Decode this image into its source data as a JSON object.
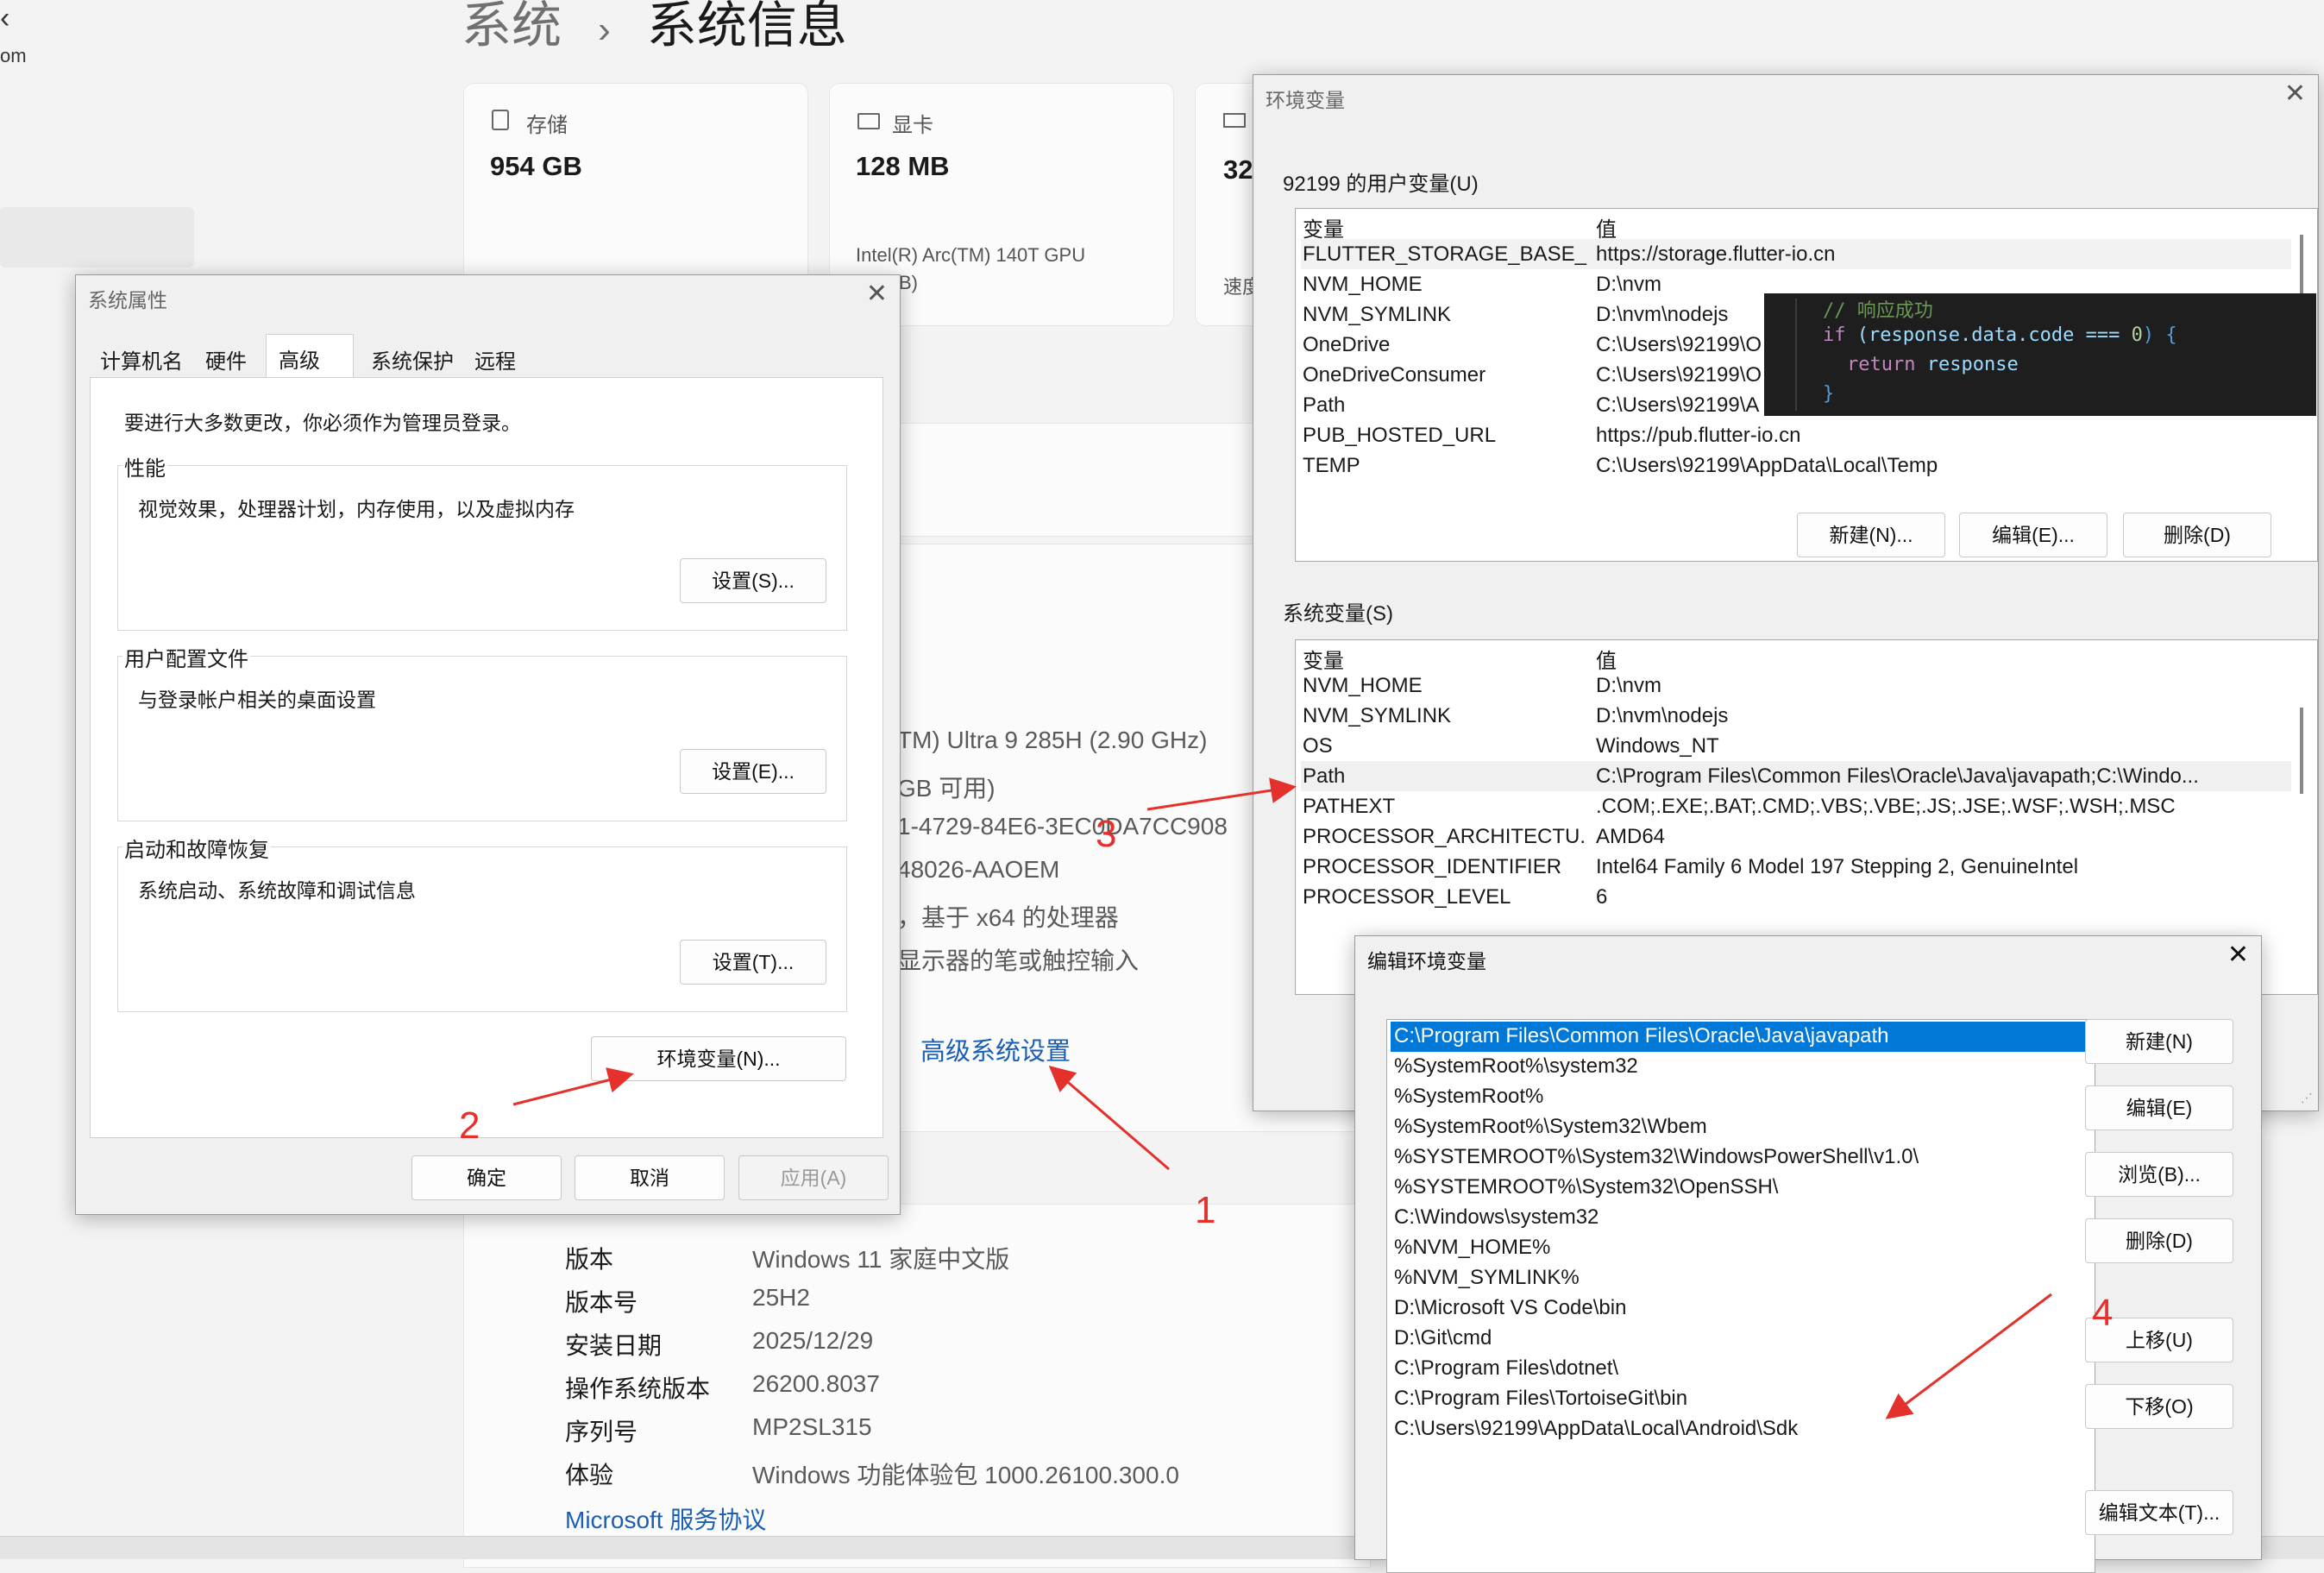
{
  "settings": {
    "partial_left": "om",
    "breadcrumb_parent": "系统",
    "breadcrumb_sep": "›",
    "breadcrumb_current": "系统信息",
    "cards": [
      {
        "label": "存储",
        "value": "954 GB",
        "sub": ""
      },
      {
        "label": "显卡",
        "value": "128 MB",
        "sub": "Intel(R) Arc(TM) 140T GPU",
        "sub2": "B)"
      },
      {
        "label": "",
        "value": "32",
        "sub": "速度"
      }
    ],
    "spec_partial": [
      "TM) Ultra 9 285H (2.90 GHz)",
      "GB 可用)",
      "1-4729-84E6-3EC0DA7CC908",
      "48026-AAOEM",
      "基于 x64 的处理器",
      "显示器的笔或触控输入"
    ],
    "spec_prefix_comma": "，",
    "advanced_link": "高级系统设置",
    "windows_specs": [
      {
        "k": "版本",
        "v": "Windows 11 家庭中文版"
      },
      {
        "k": "版本号",
        "v": "25H2"
      },
      {
        "k": "安装日期",
        "v": "2025/12/29"
      },
      {
        "k": "操作系统版本",
        "v": "26200.8037"
      },
      {
        "k": "序列号",
        "v": "MP2SL315"
      },
      {
        "k": "体验",
        "v": "Windows 功能体验包 1000.26100.300.0"
      }
    ],
    "msa_link": "Microsoft 服务协议"
  },
  "sysprops": {
    "title": "系统属性",
    "close": "✕",
    "tabs": [
      "计算机名",
      "硬件",
      "高级",
      "系统保护",
      "远程"
    ],
    "admin_note": "要进行大多数更改，你必须作为管理员登录。",
    "groups": [
      {
        "label": "性能",
        "desc": "视觉效果，处理器计划，内存使用，以及虚拟内存",
        "button": "设置(S)..."
      },
      {
        "label": "用户配置文件",
        "desc": "与登录帐户相关的桌面设置",
        "button": "设置(E)..."
      },
      {
        "label": "启动和故障恢复",
        "desc": "系统启动、系统故障和调试信息",
        "button": "设置(T)..."
      }
    ],
    "env_button": "环境变量(N)...",
    "ok": "确定",
    "cancel": "取消",
    "apply": "应用(A)"
  },
  "envvars": {
    "title": "环境变量",
    "close": "✕",
    "user_label": "92199 的用户变量(U)",
    "col_var": "变量",
    "col_val": "值",
    "user_vars": [
      {
        "k": "FLUTTER_STORAGE_BASE_...",
        "v": "https://storage.flutter-io.cn"
      },
      {
        "k": "NVM_HOME",
        "v": "D:\\nvm"
      },
      {
        "k": "NVM_SYMLINK",
        "v": "D:\\nvm\\nodejs"
      },
      {
        "k": "OneDrive",
        "v": "C:\\Users\\92199\\O"
      },
      {
        "k": "OneDriveConsumer",
        "v": "C:\\Users\\92199\\O"
      },
      {
        "k": "Path",
        "v": "C:\\Users\\92199\\A"
      },
      {
        "k": "PUB_HOSTED_URL",
        "v": "https://pub.flutter-io.cn"
      },
      {
        "k": "TEMP",
        "v": "C:\\Users\\92199\\AppData\\Local\\Temp"
      }
    ],
    "user_buttons": [
      "新建(N)...",
      "编辑(E)...",
      "删除(D)"
    ],
    "sys_label": "系统变量(S)",
    "sys_vars": [
      {
        "k": "NVM_HOME",
        "v": "D:\\nvm"
      },
      {
        "k": "NVM_SYMLINK",
        "v": "D:\\nvm\\nodejs"
      },
      {
        "k": "OS",
        "v": "Windows_NT"
      },
      {
        "k": "Path",
        "v": "C:\\Program Files\\Common Files\\Oracle\\Java\\javapath;C:\\Windo..."
      },
      {
        "k": "PATHEXT",
        "v": ".COM;.EXE;.BAT;.CMD;.VBS;.VBE;.JS;.JSE;.WSF;.WSH;.MSC"
      },
      {
        "k": "PROCESSOR_ARCHITECTU...",
        "v": "AMD64"
      },
      {
        "k": "PROCESSOR_IDENTIFIER",
        "v": "Intel64 Family 6 Model 197 Stepping 2, GenuineIntel"
      },
      {
        "k": "PROCESSOR_LEVEL",
        "v": "6"
      }
    ]
  },
  "code_popup": {
    "comment": "// 响应成功",
    "line2_kw": "if",
    "line2_rest": " (response.data.code === ",
    "line2_num": "0",
    "line2_end": ") {",
    "line3_kw": "return",
    "line3_rest": " response",
    "line4": "}"
  },
  "editenv": {
    "title": "编辑环境变量",
    "close": "✕",
    "paths": [
      "C:\\Program Files\\Common Files\\Oracle\\Java\\javapath",
      "%SystemRoot%\\system32",
      "%SystemRoot%",
      "%SystemRoot%\\System32\\Wbem",
      "%SYSTEMROOT%\\System32\\WindowsPowerShell\\v1.0\\",
      "%SYSTEMROOT%\\System32\\OpenSSH\\",
      "C:\\Windows\\system32",
      "%NVM_HOME%",
      "%NVM_SYMLINK%",
      "D:\\Microsoft VS Code\\bin",
      "D:\\Git\\cmd",
      "C:\\Program Files\\dotnet\\",
      "C:\\Program Files\\TortoiseGit\\bin",
      "C:\\Users\\92199\\AppData\\Local\\Android\\Sdk"
    ],
    "buttons": [
      "新建(N)",
      "编辑(E)",
      "浏览(B)...",
      "删除(D)",
      "上移(U)",
      "下移(O)",
      "编辑文本(T)..."
    ]
  },
  "annotations": {
    "n1": "1",
    "n2": "2",
    "n3": "3",
    "n4": "4",
    "color": "#e5312b"
  },
  "colors": {
    "selection": "#0078d7",
    "link": "#1a5fb4",
    "code_bg": "#1e1e1e"
  }
}
